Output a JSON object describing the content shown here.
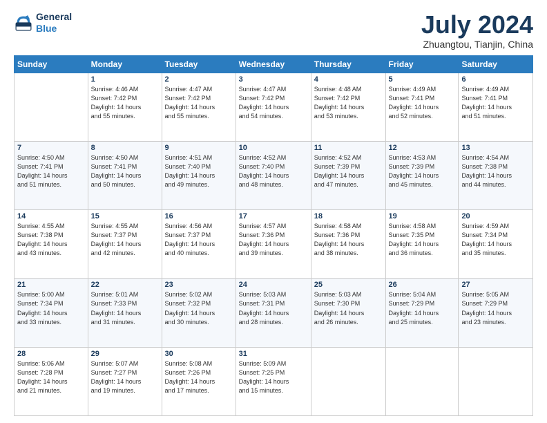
{
  "header": {
    "logo_line1": "General",
    "logo_line2": "Blue",
    "month_title": "July 2024",
    "location": "Zhuangtou, Tianjin, China"
  },
  "weekdays": [
    "Sunday",
    "Monday",
    "Tuesday",
    "Wednesday",
    "Thursday",
    "Friday",
    "Saturday"
  ],
  "weeks": [
    [
      {
        "day": "",
        "info": ""
      },
      {
        "day": "1",
        "info": "Sunrise: 4:46 AM\nSunset: 7:42 PM\nDaylight: 14 hours\nand 55 minutes."
      },
      {
        "day": "2",
        "info": "Sunrise: 4:47 AM\nSunset: 7:42 PM\nDaylight: 14 hours\nand 55 minutes."
      },
      {
        "day": "3",
        "info": "Sunrise: 4:47 AM\nSunset: 7:42 PM\nDaylight: 14 hours\nand 54 minutes."
      },
      {
        "day": "4",
        "info": "Sunrise: 4:48 AM\nSunset: 7:42 PM\nDaylight: 14 hours\nand 53 minutes."
      },
      {
        "day": "5",
        "info": "Sunrise: 4:49 AM\nSunset: 7:41 PM\nDaylight: 14 hours\nand 52 minutes."
      },
      {
        "day": "6",
        "info": "Sunrise: 4:49 AM\nSunset: 7:41 PM\nDaylight: 14 hours\nand 51 minutes."
      }
    ],
    [
      {
        "day": "7",
        "info": "Sunrise: 4:50 AM\nSunset: 7:41 PM\nDaylight: 14 hours\nand 51 minutes."
      },
      {
        "day": "8",
        "info": "Sunrise: 4:50 AM\nSunset: 7:41 PM\nDaylight: 14 hours\nand 50 minutes."
      },
      {
        "day": "9",
        "info": "Sunrise: 4:51 AM\nSunset: 7:40 PM\nDaylight: 14 hours\nand 49 minutes."
      },
      {
        "day": "10",
        "info": "Sunrise: 4:52 AM\nSunset: 7:40 PM\nDaylight: 14 hours\nand 48 minutes."
      },
      {
        "day": "11",
        "info": "Sunrise: 4:52 AM\nSunset: 7:39 PM\nDaylight: 14 hours\nand 47 minutes."
      },
      {
        "day": "12",
        "info": "Sunrise: 4:53 AM\nSunset: 7:39 PM\nDaylight: 14 hours\nand 45 minutes."
      },
      {
        "day": "13",
        "info": "Sunrise: 4:54 AM\nSunset: 7:38 PM\nDaylight: 14 hours\nand 44 minutes."
      }
    ],
    [
      {
        "day": "14",
        "info": "Sunrise: 4:55 AM\nSunset: 7:38 PM\nDaylight: 14 hours\nand 43 minutes."
      },
      {
        "day": "15",
        "info": "Sunrise: 4:55 AM\nSunset: 7:37 PM\nDaylight: 14 hours\nand 42 minutes."
      },
      {
        "day": "16",
        "info": "Sunrise: 4:56 AM\nSunset: 7:37 PM\nDaylight: 14 hours\nand 40 minutes."
      },
      {
        "day": "17",
        "info": "Sunrise: 4:57 AM\nSunset: 7:36 PM\nDaylight: 14 hours\nand 39 minutes."
      },
      {
        "day": "18",
        "info": "Sunrise: 4:58 AM\nSunset: 7:36 PM\nDaylight: 14 hours\nand 38 minutes."
      },
      {
        "day": "19",
        "info": "Sunrise: 4:58 AM\nSunset: 7:35 PM\nDaylight: 14 hours\nand 36 minutes."
      },
      {
        "day": "20",
        "info": "Sunrise: 4:59 AM\nSunset: 7:34 PM\nDaylight: 14 hours\nand 35 minutes."
      }
    ],
    [
      {
        "day": "21",
        "info": "Sunrise: 5:00 AM\nSunset: 7:34 PM\nDaylight: 14 hours\nand 33 minutes."
      },
      {
        "day": "22",
        "info": "Sunrise: 5:01 AM\nSunset: 7:33 PM\nDaylight: 14 hours\nand 31 minutes."
      },
      {
        "day": "23",
        "info": "Sunrise: 5:02 AM\nSunset: 7:32 PM\nDaylight: 14 hours\nand 30 minutes."
      },
      {
        "day": "24",
        "info": "Sunrise: 5:03 AM\nSunset: 7:31 PM\nDaylight: 14 hours\nand 28 minutes."
      },
      {
        "day": "25",
        "info": "Sunrise: 5:03 AM\nSunset: 7:30 PM\nDaylight: 14 hours\nand 26 minutes."
      },
      {
        "day": "26",
        "info": "Sunrise: 5:04 AM\nSunset: 7:29 PM\nDaylight: 14 hours\nand 25 minutes."
      },
      {
        "day": "27",
        "info": "Sunrise: 5:05 AM\nSunset: 7:29 PM\nDaylight: 14 hours\nand 23 minutes."
      }
    ],
    [
      {
        "day": "28",
        "info": "Sunrise: 5:06 AM\nSunset: 7:28 PM\nDaylight: 14 hours\nand 21 minutes."
      },
      {
        "day": "29",
        "info": "Sunrise: 5:07 AM\nSunset: 7:27 PM\nDaylight: 14 hours\nand 19 minutes."
      },
      {
        "day": "30",
        "info": "Sunrise: 5:08 AM\nSunset: 7:26 PM\nDaylight: 14 hours\nand 17 minutes."
      },
      {
        "day": "31",
        "info": "Sunrise: 5:09 AM\nSunset: 7:25 PM\nDaylight: 14 hours\nand 15 minutes."
      },
      {
        "day": "",
        "info": ""
      },
      {
        "day": "",
        "info": ""
      },
      {
        "day": "",
        "info": ""
      }
    ]
  ]
}
